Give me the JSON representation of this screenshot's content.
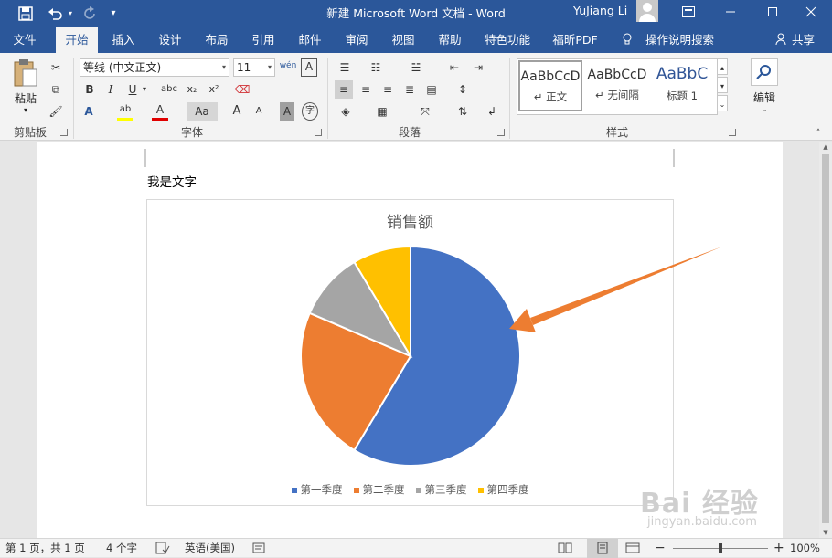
{
  "titlebar": {
    "title": "新建 Microsoft Word 文档  -  Word",
    "user": "YuJiang Li",
    "qat": {
      "save_icon": "save-icon",
      "undo_icon": "undo-icon",
      "redo_icon": "redo-icon",
      "customize_icon": "customize-qat-icon"
    },
    "window_controls": [
      "ribbon-display-options-icon",
      "minimize-icon",
      "maximize-icon",
      "close-icon"
    ]
  },
  "tabs": [
    {
      "label": "文件"
    },
    {
      "label": "开始"
    },
    {
      "label": "插入"
    },
    {
      "label": "设计"
    },
    {
      "label": "布局"
    },
    {
      "label": "引用"
    },
    {
      "label": "邮件"
    },
    {
      "label": "审阅"
    },
    {
      "label": "视图"
    },
    {
      "label": "帮助"
    },
    {
      "label": "特色功能"
    },
    {
      "label": "福昕PDF"
    }
  ],
  "active_tab": "开始",
  "tell_me": "操作说明搜索",
  "share": "共享",
  "ribbon": {
    "clipboard": {
      "label": "剪贴板",
      "paste": "粘贴"
    },
    "font": {
      "label": "字体",
      "font_name": "等线 (中文正文)",
      "font_size": "11",
      "phonetic": "wén",
      "bold": "B",
      "italic": "I",
      "underline": "U",
      "strike": "abc",
      "subscript": "x₂",
      "superscript": "x²",
      "change_case": "Aa",
      "grow": "A",
      "shrink": "A",
      "char_shading": "A",
      "enclose": "字"
    },
    "paragraph": {
      "label": "段落"
    },
    "styles": {
      "label": "样式",
      "items": [
        {
          "sample": "AaBbCcD",
          "name": "↵ 正文"
        },
        {
          "sample": "AaBbCcD",
          "name": "↵ 无间隔"
        },
        {
          "sample": "AaBbC",
          "name": "标题 1"
        }
      ]
    },
    "editing": {
      "label": "编辑"
    }
  },
  "document": {
    "body_text": "我是文字"
  },
  "chart_data": {
    "type": "pie",
    "title": "销售额",
    "categories": [
      "第一季度",
      "第二季度",
      "第三季度",
      "第四季度"
    ],
    "values": [
      8.2,
      3.2,
      1.4,
      1.2
    ],
    "colors": [
      "#4472c4",
      "#ed7d31",
      "#a5a5a5",
      "#ffc000"
    ],
    "legend": "bottom"
  },
  "annotation": {
    "arrow_color": "#ed7d31"
  },
  "watermark": {
    "logo": "Bai 经验",
    "url": "jingyan.baidu.com"
  },
  "statusbar": {
    "page": "第 1 页，共 1 页",
    "words": "4 个字",
    "language": "英语(美国)",
    "zoom": "100%",
    "zoom_minus": "−",
    "zoom_plus": "+"
  }
}
